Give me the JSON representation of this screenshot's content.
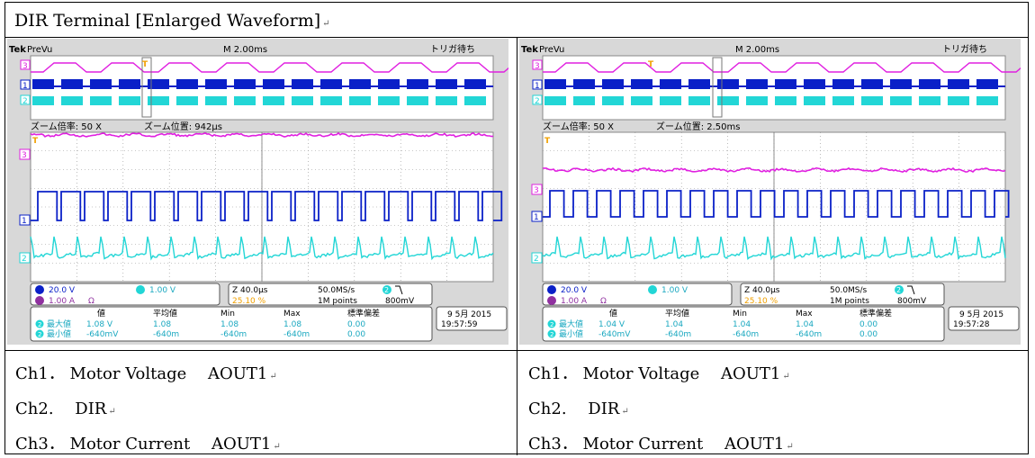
{
  "title": "DIR Terminal [Enlarged Waveform]",
  "para_mark": "↵",
  "colors": {
    "ch1": "#0a20c8",
    "ch2": "#22d6d6",
    "ch3": "#e020e0",
    "trigger": "#f0a000",
    "grid": "#909090"
  },
  "panels": [
    {
      "brand": "Tek",
      "mode": "PreVu",
      "timebase": "M 2.00ms",
      "status": "トリガ待ち",
      "zoom_ratio_label": "ズーム倍率: 50 X",
      "zoom_pos_label": "ズーム位置: 942µs",
      "ch1_scale": "20.0 V",
      "ch2_scale": "1.00 V",
      "ch3_scale": "1.00 A",
      "ohm": "Ω",
      "zoom_time": "Z 40.0µs",
      "sample_rate": "50.0MS/s",
      "trigger_pct": "25.10 %",
      "points": "1M points",
      "trigger_level": "800mV",
      "trigger_ch": "2",
      "slope_icon": "falling-edge-icon",
      "meas_headers": [
        "値",
        "平均値",
        "Min",
        "Max",
        "標準偏差"
      ],
      "meas_rows": [
        {
          "ch": "2",
          "label": "最大値",
          "values": [
            "1.08 V",
            "1.08",
            "1.08",
            "1.08",
            "0.00"
          ]
        },
        {
          "ch": "2",
          "label": "最小値",
          "values": [
            "-640mV",
            "-640m",
            "-640m",
            "-640m",
            "0.00"
          ]
        }
      ],
      "date": "9 5月 2015",
      "time": "19:57:59",
      "ch3_period": 52,
      "ch3_phase": 0,
      "caption_lines": [
        "Ch1． Motor Voltage　 AOUT1",
        "Ch2.　 DIR",
        "Ch3． Motor Current　 AOUT1"
      ]
    },
    {
      "brand": "Tek",
      "mode": "PreVu",
      "timebase": "M 2.00ms",
      "status": "トリガ待ち",
      "zoom_ratio_label": "ズーム倍率: 50 X",
      "zoom_pos_label": "ズーム位置: 2.50ms",
      "ch1_scale": "20.0 V",
      "ch2_scale": "1.00 V",
      "ch3_scale": "1.00 A",
      "ohm": "Ω",
      "zoom_time": "Z 40.0µs",
      "sample_rate": "50.0MS/s",
      "trigger_pct": "25.10 %",
      "points": "1M points",
      "trigger_level": "800mV",
      "trigger_ch": "2",
      "slope_icon": "falling-edge-icon",
      "meas_headers": [
        "値",
        "平均値",
        "Min",
        "Max",
        "標準偏差"
      ],
      "meas_rows": [
        {
          "ch": "2",
          "label": "最大値",
          "values": [
            "1.04 V",
            "1.04",
            "1.04",
            "1.04",
            "0.00"
          ]
        },
        {
          "ch": "2",
          "label": "最小値",
          "values": [
            "-640mV",
            "-640m",
            "-640m",
            "-640m",
            "0.00"
          ]
        }
      ],
      "date": "9 5月 2015",
      "time": "19:57:28",
      "ch3_period": 52,
      "ch3_phase": 1,
      "caption_lines": [
        "Ch1． Motor Voltage　 AOUT1",
        "Ch2.　 DIR",
        "Ch3． Motor Current　 AOUT1"
      ]
    }
  ]
}
